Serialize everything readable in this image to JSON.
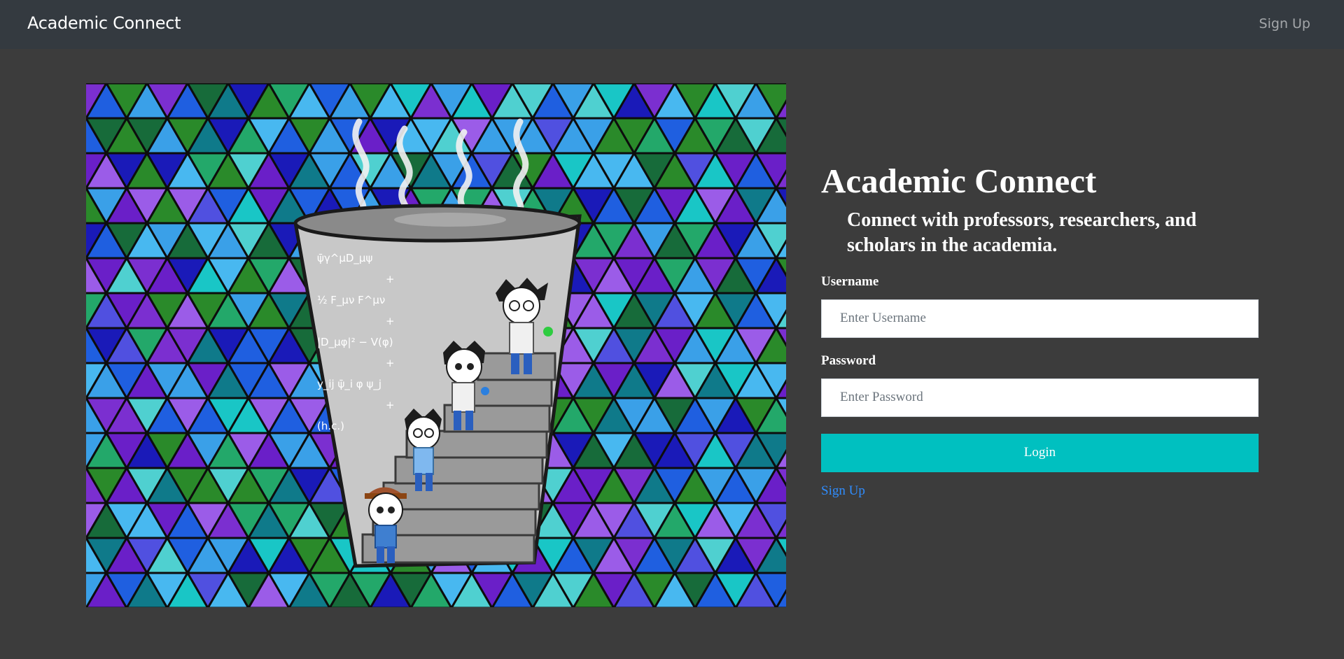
{
  "navbar": {
    "brand": "Academic Connect",
    "signup_label": "Sign Up"
  },
  "hero": {
    "image_name": "stained-glass-coffee-cup-illustration",
    "equation_lines": [
      "ψ̄γ^μD_μψ",
      "+",
      "½ F_μν F^μν",
      "+",
      "|D_μφ|² − V(φ)",
      "+",
      "y_ij ψ̄_i φ ψ_j",
      "+",
      "(h.c.)"
    ]
  },
  "panel": {
    "title": "Academic Connect",
    "subtitle": "Connect with professors, researchers, and scholars in the academia.",
    "username_label": "Username",
    "username_placeholder": "Enter Username",
    "password_label": "Password",
    "password_placeholder": "Enter Password",
    "login_label": "Login",
    "signup_link": "Sign Up"
  },
  "colors": {
    "navbar_bg": "#343a40",
    "page_bg": "#3c3c3c",
    "accent": "#00c0c0",
    "link": "#2f8dff"
  }
}
